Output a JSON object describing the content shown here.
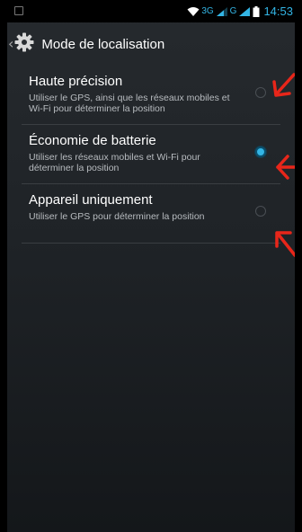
{
  "status_bar": {
    "network_3g": "3G",
    "network_g": "G",
    "time": "14:53",
    "accent_color": "#33b5e5"
  },
  "action_bar": {
    "title": "Mode de localisation",
    "icon": "gear-icon"
  },
  "options": [
    {
      "title": "Haute précision",
      "summary": "Utiliser le GPS, ainsi que les réseaux mobiles et Wi-Fi pour déterminer la position",
      "checked": false
    },
    {
      "title": "Économie de batterie",
      "summary": "Utiliser les réseaux mobiles et Wi-Fi pour déterminer la position",
      "checked": true
    },
    {
      "title": "Appareil uniquement",
      "summary": "Utiliser le GPS pour déterminer la position",
      "checked": false
    }
  ],
  "annotation_color": "#e8261a"
}
